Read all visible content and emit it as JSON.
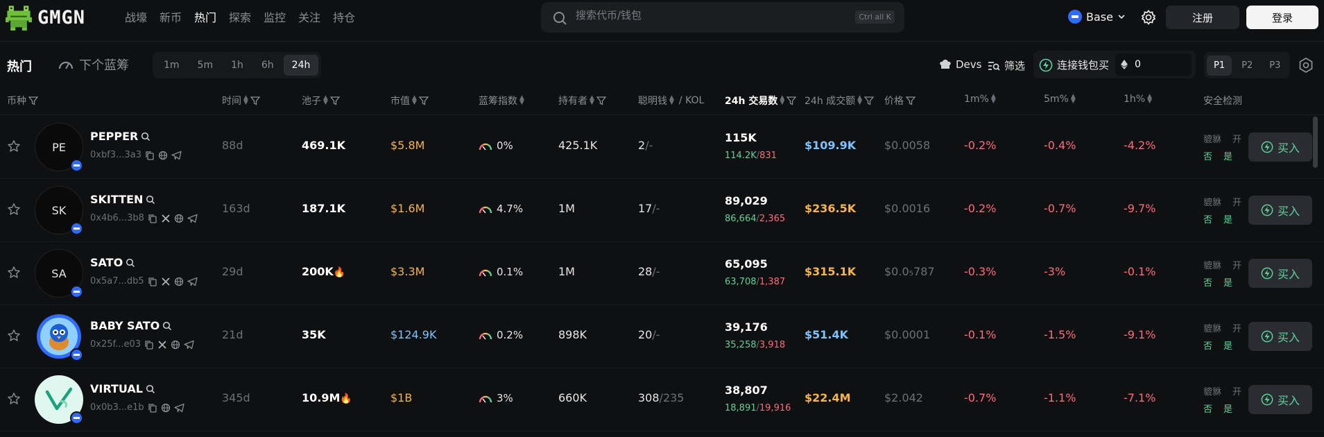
{
  "nav": {
    "brand": "GMGN",
    "items": [
      "战壕",
      "新币",
      "热门",
      "探索",
      "监控",
      "关注",
      "持仓"
    ],
    "active_index": 2
  },
  "search": {
    "placeholder": "搜索代币/钱包",
    "shortcut": "Ctrl all K"
  },
  "chain_selector": {
    "label": "Base"
  },
  "auth": {
    "register": "注册",
    "login": "登录"
  },
  "subbar": {
    "title": "热门",
    "next_label": "下个蓝筹",
    "timeframes": [
      "1m",
      "5m",
      "1h",
      "6h",
      "24h"
    ],
    "active_timeframe": "24h",
    "devs_label": "Devs",
    "filter_label": "筛选",
    "wallet_buy_label": "连接钱包买",
    "wallet_amount": "0",
    "pages": [
      "P1",
      "P2",
      "P3"
    ],
    "active_page": "P1"
  },
  "table": {
    "headers": {
      "token": "币种",
      "time": "时间",
      "pool": "池子",
      "mcap": "市值",
      "bluechip": "蓝筹指数",
      "holders": "持有者",
      "smart": "聪明钱",
      "kol": "/ KOL",
      "tx24h": "24h 交易数",
      "vol24h": "24h 成交额",
      "price": "价格",
      "ch1m": "1m%",
      "ch5m": "5m%",
      "ch1h": "1h%",
      "safety": "安全检测"
    },
    "safety_labels": {
      "a": "貔貅",
      "b": "开"
    },
    "buy_label": "买入",
    "rows": [
      {
        "initials": "PE",
        "name": "PEPPER",
        "address": "0xbf3...3a3",
        "socials": [
          "copy",
          "globe",
          "telegram"
        ],
        "age": "88d",
        "pool": "469.1K",
        "pool_fire": false,
        "mcap": "$5.8M",
        "mcap_color": "orange",
        "bluechip": "0%",
        "holders": "425.1K",
        "smart": "2",
        "kol": "/-",
        "tx": "115K",
        "buys": "114.2K",
        "sells": "831",
        "vol": "$109.9K",
        "vol_color": "blue",
        "price": "$0.0058",
        "c1m": "-0.2%",
        "c5m": "-0.4%",
        "c1h": "-4.2%",
        "safe_a": "否",
        "safe_b": "是"
      },
      {
        "initials": "SK",
        "name": "SKITTEN",
        "address": "0x4b6...3b8",
        "socials": [
          "copy",
          "x",
          "globe",
          "telegram"
        ],
        "age": "163d",
        "pool": "187.1K",
        "pool_fire": false,
        "mcap": "$1.6M",
        "mcap_color": "orange",
        "bluechip": "4.7%",
        "holders": "1M",
        "smart": "17",
        "kol": "/-",
        "tx": "89,029",
        "buys": "86,664",
        "sells": "2,365",
        "vol": "$236.5K",
        "vol_color": "orange",
        "price": "$0.0016",
        "c1m": "-0.2%",
        "c5m": "-0.7%",
        "c1h": "-9.7%",
        "safe_a": "否",
        "safe_b": "是"
      },
      {
        "initials": "SA",
        "name": "SATO",
        "address": "0x5a7...db5",
        "socials": [
          "copy",
          "x",
          "globe",
          "telegram"
        ],
        "age": "29d",
        "pool": "200K",
        "pool_fire": true,
        "mcap": "$3.3M",
        "mcap_color": "orange",
        "bluechip": "0.1%",
        "holders": "1M",
        "smart": "28",
        "kol": "/-",
        "tx": "65,095",
        "buys": "63,708",
        "sells": "1,387",
        "vol": "$315.1K",
        "vol_color": "orange",
        "price": "$0.0₅787",
        "c1m": "-0.3%",
        "c5m": "-3%",
        "c1h": "-0.1%",
        "safe_a": "否",
        "safe_b": "是"
      },
      {
        "initials": "",
        "name": "BABY SATO",
        "address": "0x25f...e03",
        "socials": [
          "copy",
          "x",
          "globe",
          "telegram"
        ],
        "age": "21d",
        "pool": "35K",
        "pool_fire": false,
        "mcap": "$124.9K",
        "mcap_color": "blue",
        "bluechip": "0.2%",
        "holders": "898K",
        "smart": "20",
        "kol": "/-",
        "tx": "39,176",
        "buys": "35,258",
        "sells": "3,918",
        "vol": "$51.4K",
        "vol_color": "blue",
        "price": "$0.0001",
        "c1m": "-0.1%",
        "c5m": "-1.5%",
        "c1h": "-9.1%",
        "safe_a": "否",
        "safe_b": "是"
      },
      {
        "initials": "",
        "name": "VIRTUAL",
        "address": "0x0b3...e1b",
        "socials": [
          "copy",
          "globe",
          "telegram"
        ],
        "age": "345d",
        "pool": "10.9M",
        "pool_fire": true,
        "mcap": "$1B",
        "mcap_color": "orange",
        "bluechip": "3%",
        "holders": "660K",
        "smart": "308",
        "kol": "/235",
        "tx": "38,807",
        "buys": "18,891",
        "sells": "19,916",
        "vol": "$22.4M",
        "vol_color": "orange",
        "price": "$2.042",
        "c1m": "-0.7%",
        "c5m": "-1.1%",
        "c1h": "-7.1%",
        "safe_a": "否",
        "safe_b": "是"
      }
    ]
  },
  "colors": {
    "accent_green": "#5dd39e",
    "accent_red": "#ff6b7a",
    "accent_orange": "#f6b44b",
    "accent_blue": "#7cc4ff",
    "base_chain": "#2f6bff"
  }
}
